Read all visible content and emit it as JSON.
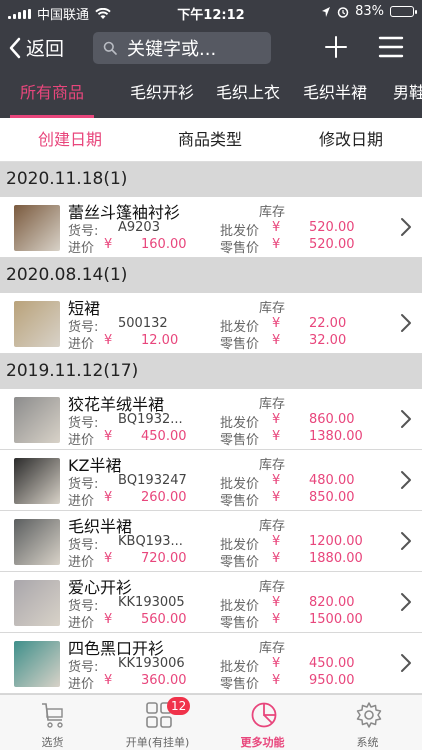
{
  "status": {
    "carrier": "中国联通",
    "time": "下午12:12",
    "battery": "83%",
    "battery_level": 0.83
  },
  "nav": {
    "back_label": "返回",
    "search_placeholder": "关键字或..."
  },
  "category_tabs": [
    {
      "label": "所有商品",
      "active": true
    },
    {
      "label": "毛织开衫",
      "active": false
    },
    {
      "label": "毛织上衣",
      "active": false
    },
    {
      "label": "毛织半裙",
      "active": false
    },
    {
      "label": "男鞋",
      "active": false
    }
  ],
  "sort_tabs": [
    {
      "label": "创建日期",
      "active": true
    },
    {
      "label": "商品类型",
      "active": false
    },
    {
      "label": "修改日期",
      "active": false
    }
  ],
  "labels": {
    "code": "货号:",
    "cost": "进价",
    "stock": "库存",
    "wholesale": "批发价",
    "retail": "零售价",
    "yen": "¥"
  },
  "groups": [
    {
      "header": "2020.11.18(1)",
      "items": [
        {
          "name": "蕾丝斗篷袖衬衫",
          "code": "A9203",
          "cost": "160.00",
          "wholesale": "520.00",
          "retail": "520.00",
          "thumb": "#7a5a3e"
        }
      ]
    },
    {
      "header": "2020.08.14(1)",
      "items": [
        {
          "name": "短裙",
          "code": "500132",
          "cost": "12.00",
          "wholesale": "22.00",
          "retail": "32.00",
          "thumb": "#b9a27a"
        }
      ]
    },
    {
      "header": "2019.11.12(17)",
      "items": [
        {
          "name": "狡花羊绒半裙",
          "code": "BQ1932...",
          "cost": "450.00",
          "wholesale": "860.00",
          "retail": "1380.00",
          "thumb": "#8c8c8c"
        },
        {
          "name": "KZ半裙",
          "code": "BQ193247",
          "cost": "260.00",
          "wholesale": "480.00",
          "retail": "850.00",
          "thumb": "#2b2b2b"
        },
        {
          "name": "毛织半裙",
          "code": "KBQ193...",
          "cost": "720.00",
          "wholesale": "1200.00",
          "retail": "1880.00",
          "thumb": "#5b5e5f"
        },
        {
          "name": "爱心开衫",
          "code": "KK193005",
          "cost": "560.00",
          "wholesale": "820.00",
          "retail": "1500.00",
          "thumb": "#a9a6ab"
        },
        {
          "name": "四色黑口开衫",
          "code": "KK193006",
          "cost": "360.00",
          "wholesale": "450.00",
          "retail": "950.00",
          "thumb": "#3f8f8a"
        }
      ]
    }
  ],
  "tabbar": [
    {
      "label": "选货",
      "icon": "cart-icon",
      "active": false,
      "badge": ""
    },
    {
      "label": "开单(有挂单)",
      "icon": "grid-icon",
      "active": false,
      "badge": "12"
    },
    {
      "label": "更多功能",
      "icon": "pie-icon",
      "active": true,
      "badge": ""
    },
    {
      "label": "系统",
      "icon": "gear-icon",
      "active": false,
      "badge": ""
    }
  ],
  "colors": {
    "accent": "#e8467c",
    "header_bg": "#3b3d44",
    "group_bg": "#d7d7d7"
  }
}
